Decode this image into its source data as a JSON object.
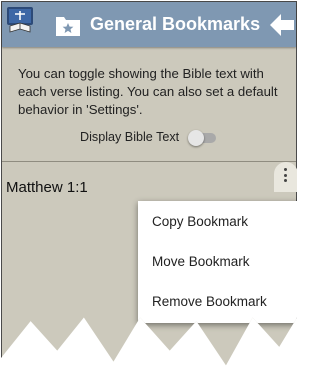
{
  "header": {
    "title": "General Bookmarks",
    "app_icon": "bible-app-icon",
    "folder_icon": "bookmark-folder-icon",
    "back_icon": "back-arrow-icon",
    "bar_color": "#7f98b2"
  },
  "info": {
    "text": "You can toggle showing the Bible text with each verse listing. You can also set a default behavior in 'Settings'."
  },
  "toggle": {
    "label": "Display Bible Text",
    "state": "off"
  },
  "bookmarks": [
    {
      "label": "Matthew 1:1"
    }
  ],
  "context_menu": {
    "items": [
      "Copy Bookmark",
      "Move Bookmark",
      "Remove Bookmark"
    ]
  }
}
